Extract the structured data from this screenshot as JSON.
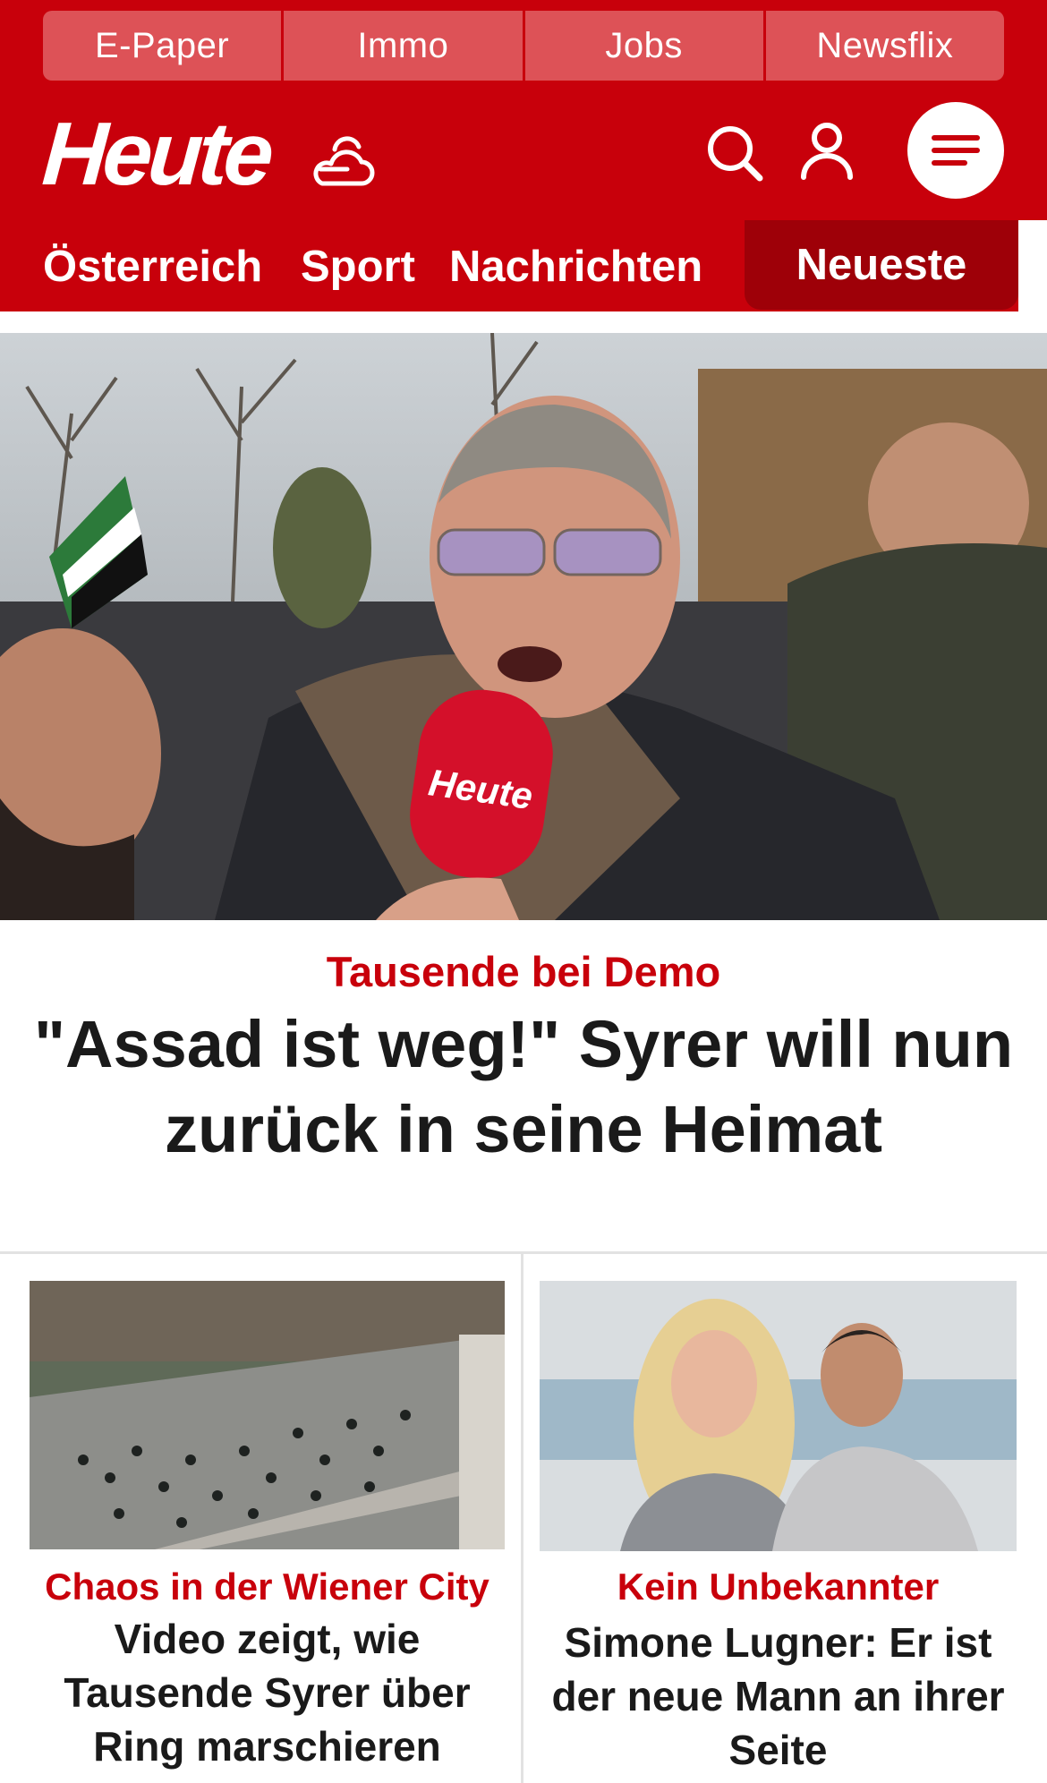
{
  "topnav": [
    "E-Paper",
    "Immo",
    "Jobs",
    "Newsflix"
  ],
  "brand": {
    "logo": "Heute",
    "accent": "#c8000b",
    "accent_dark": "#9e0008"
  },
  "icons": [
    "cloud-sun-icon",
    "search-icon",
    "user-icon",
    "menu-icon"
  ],
  "sections": {
    "oesterreich": "Österreich",
    "sport": "Sport",
    "nachrichten": "Nachrichten",
    "neueste": "Neueste"
  },
  "hero": {
    "kicker": "Tausende bei Demo",
    "title_line1": "\"Assad ist weg!\" Syrer will nun",
    "title_line2": "zurück in seine Heimat",
    "mic_label": "Heute"
  },
  "cards": [
    {
      "kicker": "Chaos in der Wiener City",
      "title_line1": "Video zeigt, wie",
      "title_line2": "Tausende Syrer über",
      "title_line3": "Ring marschieren"
    },
    {
      "kicker": "Kein Unbekannter",
      "title_line1": "Simone Lugner: Er ist",
      "title_line2": "der neue Mann an ihrer",
      "title_line3": "Seite"
    }
  ]
}
